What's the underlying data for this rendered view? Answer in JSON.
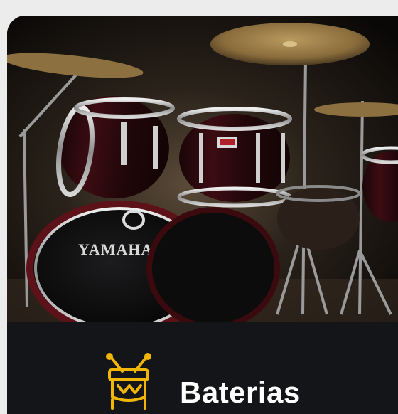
{
  "card": {
    "title": "Baterias",
    "icon": "drum-icon",
    "image": "drum-kit-photo",
    "drum_brand": "YAMAHA"
  },
  "colors": {
    "background": "#ececec",
    "footer": "#131518",
    "title": "#ffffff",
    "icon_accent": "#f2b705"
  }
}
